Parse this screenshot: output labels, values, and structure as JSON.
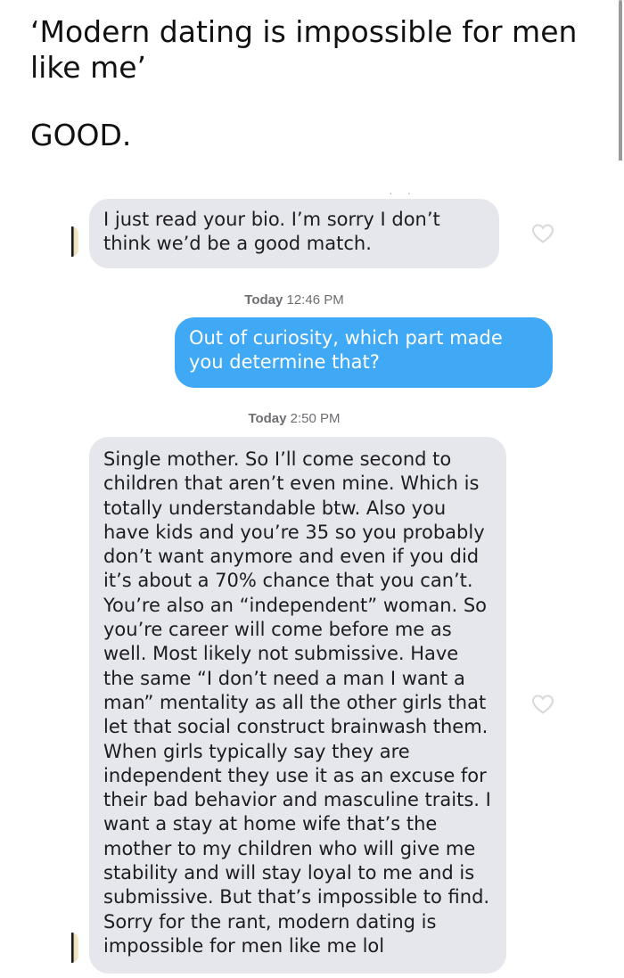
{
  "post": {
    "line_1": "‘Modern dating is impossible for men like me’",
    "line_2": "GOOD."
  },
  "chat": {
    "messages": [
      {
        "side": "incoming",
        "text": "I just read your bio. I’m sorry I don’t think we’d be a good match."
      },
      {
        "side": "outgoing",
        "text": "Out of curiosity, which part made you determine that?"
      },
      {
        "side": "incoming",
        "text": "Single mother. So I’ll come second to children that aren’t even mine. Which is totally understandable btw. Also you have kids and you’re 35 so you probably don’t want anymore and even if you did it’s about a 70% chance that you can’t. You’re also an “independent” woman. So you’re career will come before me as well. Most likely not submissive. Have the same “I don’t need a man I want a man” mentality as all the other girls that let that social construct brainwash them. When girls typically say they are independent they use it as an excuse for their bad behavior and masculine traits. I want a stay at home wife that’s the mother to my children who will give me stability and will stay loyal to me and is submissive. But that’s impossible to find. Sorry for the rant, modern dating is impossible for men like me lol"
      }
    ],
    "timestamps": [
      {
        "day": "Today",
        "time": "12:46 PM"
      },
      {
        "day": "Today",
        "time": "2:50 PM"
      }
    ]
  },
  "icons": {
    "like": "heart-outline-icon",
    "avatar": "avatar-thumbnail"
  },
  "colors": {
    "incoming_bubble": "#e6e7ec",
    "outgoing_bubble": "#3fa9f5",
    "timestamp_text": "#6e6e73"
  }
}
